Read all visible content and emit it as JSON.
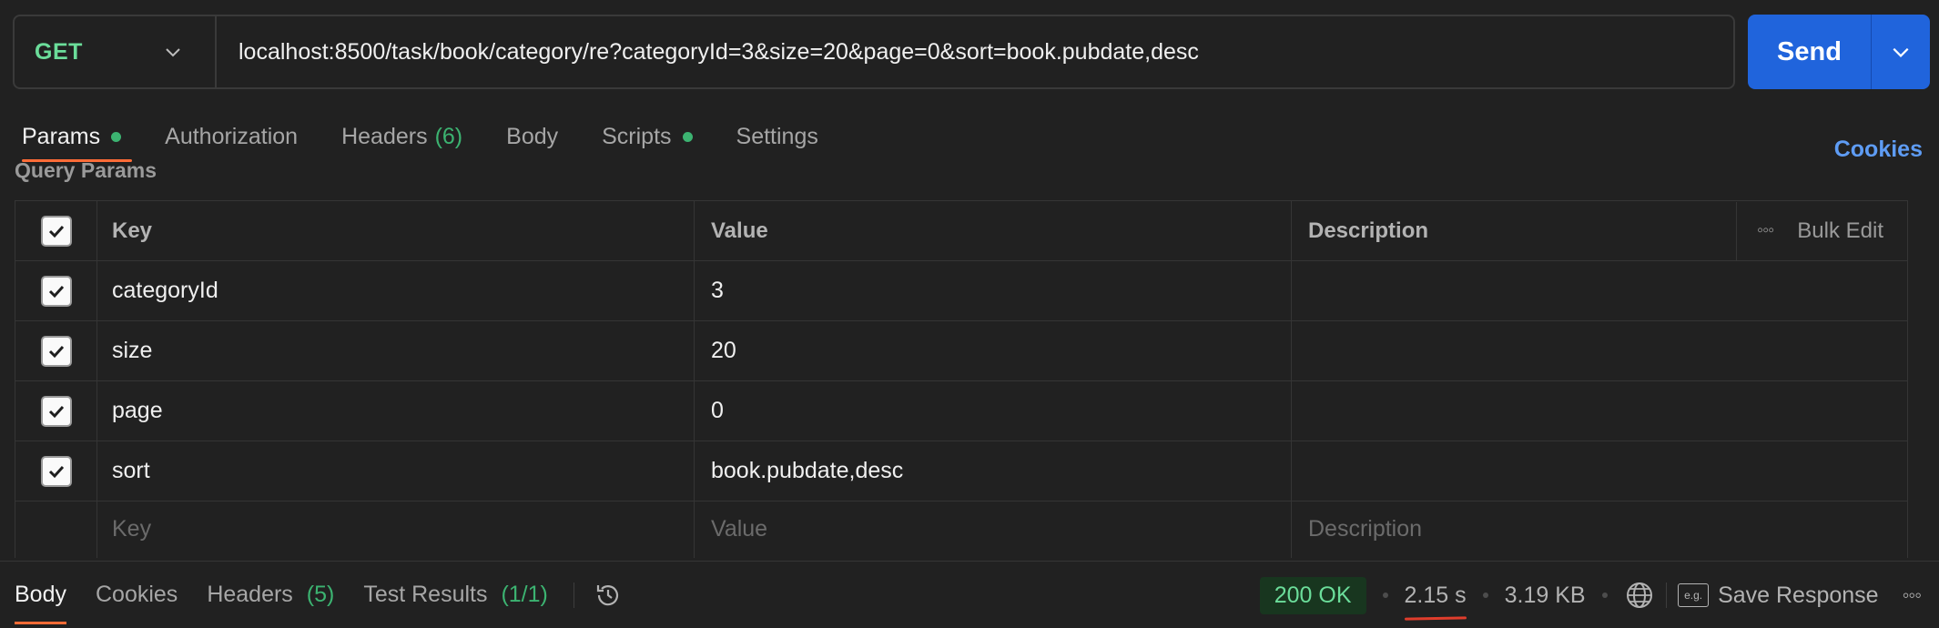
{
  "request": {
    "method": "GET",
    "url": "localhost:8500/task/book/category/re?categoryId=3&size=20&page=0&sort=book.pubdate,desc",
    "send_label": "Send"
  },
  "tabs": [
    {
      "label": "Params",
      "dot": true,
      "active": true
    },
    {
      "label": "Authorization"
    },
    {
      "label": "Headers",
      "count": "(6)"
    },
    {
      "label": "Body"
    },
    {
      "label": "Scripts",
      "dot": true
    },
    {
      "label": "Settings"
    }
  ],
  "cookies_label": "Cookies",
  "query_params": {
    "title": "Query Params",
    "headers": {
      "key": "Key",
      "value": "Value",
      "description": "Description",
      "bulk_edit": "Bulk Edit"
    },
    "rows": [
      {
        "key": "categoryId",
        "value": "3",
        "description": "",
        "checked": true
      },
      {
        "key": "size",
        "value": "20",
        "description": "",
        "checked": true
      },
      {
        "key": "page",
        "value": "0",
        "description": "",
        "checked": true
      },
      {
        "key": "sort",
        "value": "book.pubdate,desc",
        "description": "",
        "checked": true
      }
    ],
    "placeholders": {
      "key": "Key",
      "value": "Value",
      "description": "Description"
    }
  },
  "response": {
    "tabs": [
      {
        "label": "Body",
        "active": true
      },
      {
        "label": "Cookies"
      },
      {
        "label": "Headers",
        "count": "(5)"
      },
      {
        "label": "Test Results",
        "count": "(1/1)"
      }
    ],
    "status": "200 OK",
    "time": "2.15 s",
    "size": "3.19 KB",
    "save_label": "Save Response",
    "save_icon_text": "e.g."
  },
  "colors": {
    "accent": "#ff6c37",
    "send": "#2064dc",
    "success": "#6bdd9a",
    "link": "#5e9cf4"
  },
  "icons": [
    "chevron-down-icon",
    "checkbox-icon",
    "more-icon",
    "history-icon",
    "globe-icon",
    "save-response-icon"
  ]
}
